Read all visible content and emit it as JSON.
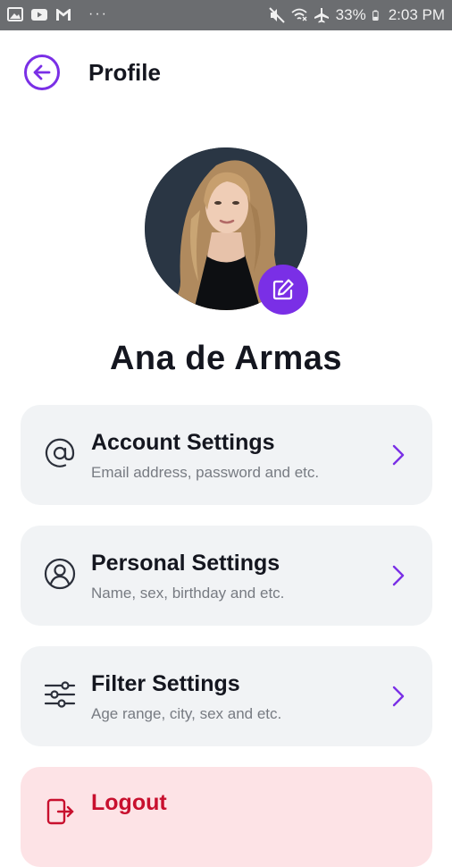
{
  "status_bar": {
    "battery": "33%",
    "time": "2:03 PM",
    "dots": "···",
    "icons": [
      "image-icon",
      "youtube-icon",
      "gmail-icon",
      "mute-icon",
      "wifi-icon",
      "airplane-icon",
      "battery-icon"
    ]
  },
  "header": {
    "back_icon": "arrow-left-icon",
    "title": "Profile"
  },
  "profile": {
    "name": "Ana de Armas",
    "edit_icon": "pencil-icon"
  },
  "settings": [
    {
      "icon": "at-icon",
      "title": "Account Settings",
      "subtitle": "Email address, password and etc."
    },
    {
      "icon": "user-circle-icon",
      "title": "Personal Settings",
      "subtitle": "Name, sex, birthday and etc."
    },
    {
      "icon": "sliders-icon",
      "title": "Filter Settings",
      "subtitle": "Age range, city, sex and etc."
    }
  ],
  "logout": {
    "icon": "logout-icon",
    "title": "Logout"
  },
  "colors": {
    "accent": "#7a2fe6",
    "card_bg": "#f1f3f5",
    "logout_bg": "#fde3e6",
    "logout_text": "#c8102e",
    "status_bar": "#6b6d70"
  }
}
